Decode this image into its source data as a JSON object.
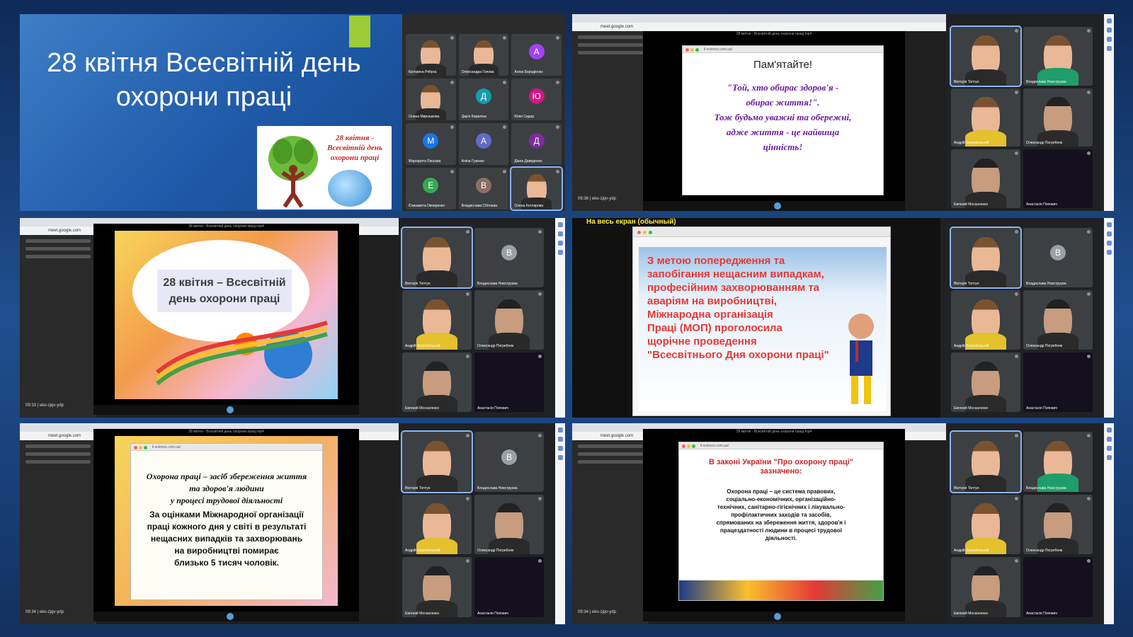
{
  "panel1": {
    "slide_title": "28 квітня Всесвітній день охорони праці",
    "logo_text": "28 квітня - Всесвітній день охорони праці",
    "participants": [
      {
        "name": "Катерина Рябуха",
        "type": "video"
      },
      {
        "name": "Олександра Голова",
        "type": "video"
      },
      {
        "name": "Аліна Бородіонко",
        "type": "avatar",
        "letter": "А",
        "color": "#a142f4"
      },
      {
        "name": "Олена Мирошкова",
        "type": "video"
      },
      {
        "name": "Дар'я Бариліна",
        "type": "avatar",
        "letter": "Д",
        "color": "#129eaf"
      },
      {
        "name": "Юлія Сидор",
        "type": "avatar",
        "letter": "Ю",
        "color": "#d01884"
      },
      {
        "name": "Маргарита Євсєєва",
        "type": "avatar",
        "letter": "М",
        "color": "#1a73e8"
      },
      {
        "name": "Аліна Гузенко",
        "type": "avatar",
        "letter": "А",
        "color": "#5f6bc8"
      },
      {
        "name": "Діана Давиденко",
        "type": "avatar",
        "letter": "Д",
        "color": "#7b2d9b"
      },
      {
        "name": "Єлизавета Овчаренко",
        "type": "avatar",
        "letter": "Е",
        "color": "#34a853"
      },
      {
        "name": "Владислава Сбітнєва",
        "type": "avatar",
        "letter": "В",
        "color": "#8d6e63"
      },
      {
        "name": "Олена Котлярова",
        "type": "video"
      }
    ]
  },
  "panel2": {
    "time": "09:36",
    "meeting_code": "eko-zjqv-ydp",
    "slide_heading": "Пам'ятайте!",
    "slide_lines": [
      "\"Той, хто обирає здоров'я -",
      "обирає життя!\".",
      "Тож будьмо уважні та обережні,",
      "адже життя - це найвища",
      "цінність!"
    ]
  },
  "panel3": {
    "time": "09:33",
    "meeting_code": "eko-zjqv-ydp",
    "slide_lines": [
      "28 квітня – Всесвітній",
      "день охорони праці"
    ]
  },
  "panel4": {
    "fullscreen_label": "На весь екран (обычный)",
    "slide_lines": [
      "З метою попередження та",
      "запобігання нещасним випадкам,",
      "професійним захворюванням та",
      "аваріям на виробництві,",
      "Міжнародна організація",
      "Праці (МОП) проголосила",
      "щорічне проведення",
      "\"Всесвітнього Дня охорони праці\""
    ]
  },
  "panel5": {
    "time": "09:34",
    "meeting_code": "eko-zjqv-ydp",
    "slide_title_lines": [
      "Охорона праці – засіб збереження життя",
      "та здоров'я людини",
      "у процесі трудової діяльності"
    ],
    "slide_body_lines": [
      "За оцінками Міжнародної організації",
      "праці кожного дня у світі в результаті",
      "нещасних випадків та захворювань",
      "на виробництві помирає",
      "близько 5 тисяч чоловік."
    ]
  },
  "panel6": {
    "time": "09:34",
    "meeting_code": "eko-zjqv-ydp",
    "slide_title_lines": [
      "В законі України \"Про охорону праці\"",
      "зазначено:"
    ],
    "slide_body_lines": [
      "Охорона праці – це система правових,",
      "соціально-економічних, організаційно-",
      "технічних, санітарно-гігієнічних і лікувально-",
      "профілактичних заходів та засобів,",
      "спрямованих на збереження життя, здоров'я і",
      "працездатності людини в процесі трудової",
      "діяльності."
    ]
  },
  "shared_participants": {
    "names": [
      "Вікторія Топтун",
      "Владислава Невструєва",
      "Андрій Загребельний",
      "Олександр Погребняк",
      "Евгений Москаленко",
      "Анастасія Попович"
    ],
    "avatar_letter": "В"
  },
  "browser": {
    "address": "meet.google.com",
    "inner_address": "il-science.com.ua/",
    "video_title": "28 квітня - Всесвітній день охорони праці.mp4"
  }
}
